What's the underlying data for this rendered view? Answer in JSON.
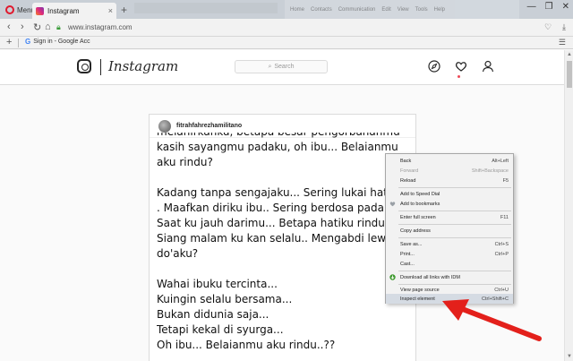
{
  "browser": {
    "menu_label": "Menu",
    "tab_title": "Instagram",
    "tab_close": "×",
    "new_tab": "+",
    "window_controls": [
      "—",
      "❐",
      "✕"
    ],
    "background_menu": [
      "Home",
      "Contacts",
      "Communication",
      "Edit",
      "View",
      "Tools",
      "Help"
    ],
    "back": "‹",
    "forward": "›",
    "reload": "↻",
    "home": "⌂",
    "url": "www.instagram.com",
    "bookmark_plus": "+",
    "bookmark_item": "Sign in - Google Acc"
  },
  "instagram": {
    "wordmark": "Instagram",
    "search_placeholder": "Search",
    "post": {
      "username": "fitrahfahrezhamilitano",
      "caption_lines": [
        "melahirkanku, betapa besar pengorbananmu",
        "kasih sayangmu padaku, oh ibu... Belaianmu",
        "aku rindu?",
        "",
        "Kadang tanpa sengajaku... Sering lukai hatimu",
        ". Maafkan diriku ibu.. Sering berdosa padamu",
        "Saat ku jauh darimu... Betapa hatiku rindu..",
        "Siang malam ku kan selalu.. Mengabdi lewat",
        "do'aku?",
        "",
        "Wahai ibuku tercinta...",
        "Kuingin selalu bersama...",
        "Bukan didunia saja...",
        "Tetapi kekal di syurga...",
        "Oh ibu... Belaianmu aku rindu..??"
      ]
    }
  },
  "context_menu": {
    "items": [
      {
        "label": "Back",
        "shortcut": "Alt+Left",
        "disabled": false
      },
      {
        "label": "Forward",
        "shortcut": "Shift+Backspace",
        "disabled": true
      },
      {
        "label": "Reload",
        "shortcut": "F5",
        "disabled": false
      },
      {
        "label": "Add to Speed Dial",
        "shortcut": "",
        "disabled": false
      },
      {
        "label": "Add to bookmarks",
        "shortcut": "",
        "disabled": false
      },
      {
        "label": "Enter full screen",
        "shortcut": "F11",
        "disabled": false
      },
      {
        "label": "Copy address",
        "shortcut": "",
        "disabled": false
      },
      {
        "label": "Save as...",
        "shortcut": "Ctrl+S",
        "disabled": false
      },
      {
        "label": "Print...",
        "shortcut": "Ctrl+P",
        "disabled": false
      },
      {
        "label": "Cast...",
        "shortcut": "",
        "disabled": false
      },
      {
        "label": "Download all links with IDM",
        "shortcut": "",
        "disabled": false
      },
      {
        "label": "View page source",
        "shortcut": "Ctrl+U",
        "disabled": false
      },
      {
        "label": "Inspect element",
        "shortcut": "Ctrl+Shift+C",
        "disabled": false,
        "highlighted": true
      }
    ]
  },
  "colors": {
    "opera_red": "#e0192d",
    "annotation_arrow": "#e3201b",
    "menu_highlight": "#d5dbe3"
  }
}
